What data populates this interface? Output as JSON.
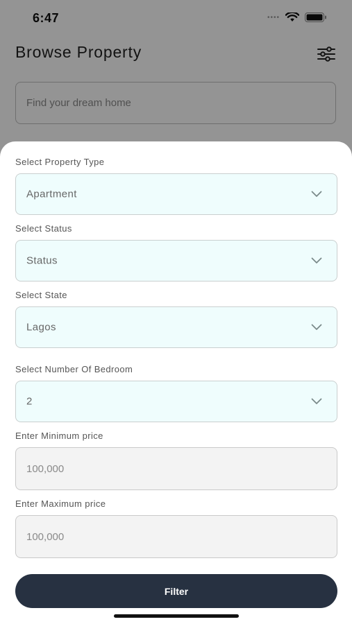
{
  "status_bar": {
    "time": "6:47",
    "signal_dots": "••••"
  },
  "header": {
    "title": "Browse Property"
  },
  "search": {
    "placeholder": "Find your dream home"
  },
  "filter_sheet": {
    "property_type": {
      "label": "Select Property Type",
      "value": "Apartment"
    },
    "status": {
      "label": "Select Status",
      "value": "Status"
    },
    "state": {
      "label": "Select State",
      "value": "Lagos"
    },
    "bedrooms": {
      "label": "Select Number Of Bedroom",
      "value": "2"
    },
    "min_price": {
      "label": "Enter Minimum price",
      "placeholder": "100,000"
    },
    "max_price": {
      "label": "Enter Maximum price",
      "placeholder": "100,000"
    },
    "filter_button": {
      "label": "Filter"
    }
  },
  "colors": {
    "select_bg": "#effdfd",
    "input_bg": "#f3f3f3",
    "button_bg": "#273141",
    "overlay": "rgba(0,0,0,0.42)"
  },
  "icons": {
    "header_action": "filter-sliders-icon",
    "select_indicator": "chevron-down-icon",
    "wifi": "wifi-icon",
    "battery": "battery-icon"
  }
}
